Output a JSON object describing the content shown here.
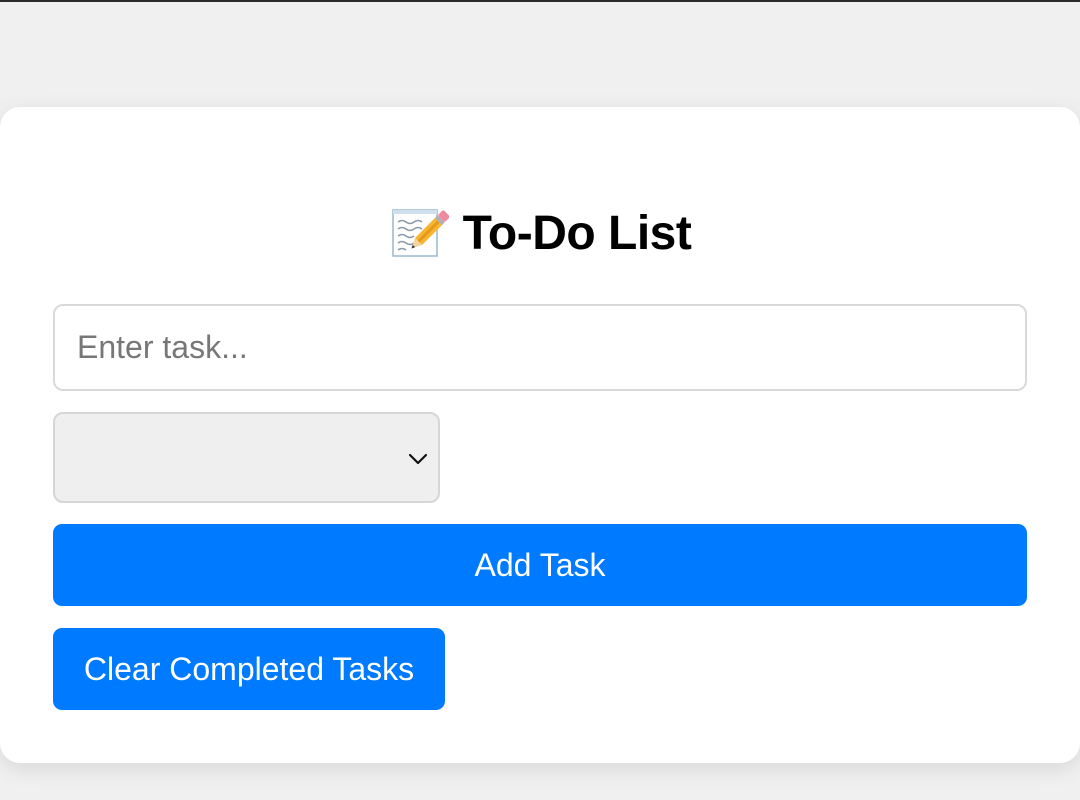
{
  "header": {
    "icon": "memo-icon",
    "title": "To-Do List"
  },
  "task_input": {
    "value": "",
    "placeholder": "Enter task..."
  },
  "category_select": {
    "selected": ""
  },
  "buttons": {
    "add_label": "Add Task",
    "clear_label": "Clear Completed Tasks"
  },
  "colors": {
    "accent": "#007bff",
    "background": "#f0f0f0",
    "card": "#ffffff"
  }
}
